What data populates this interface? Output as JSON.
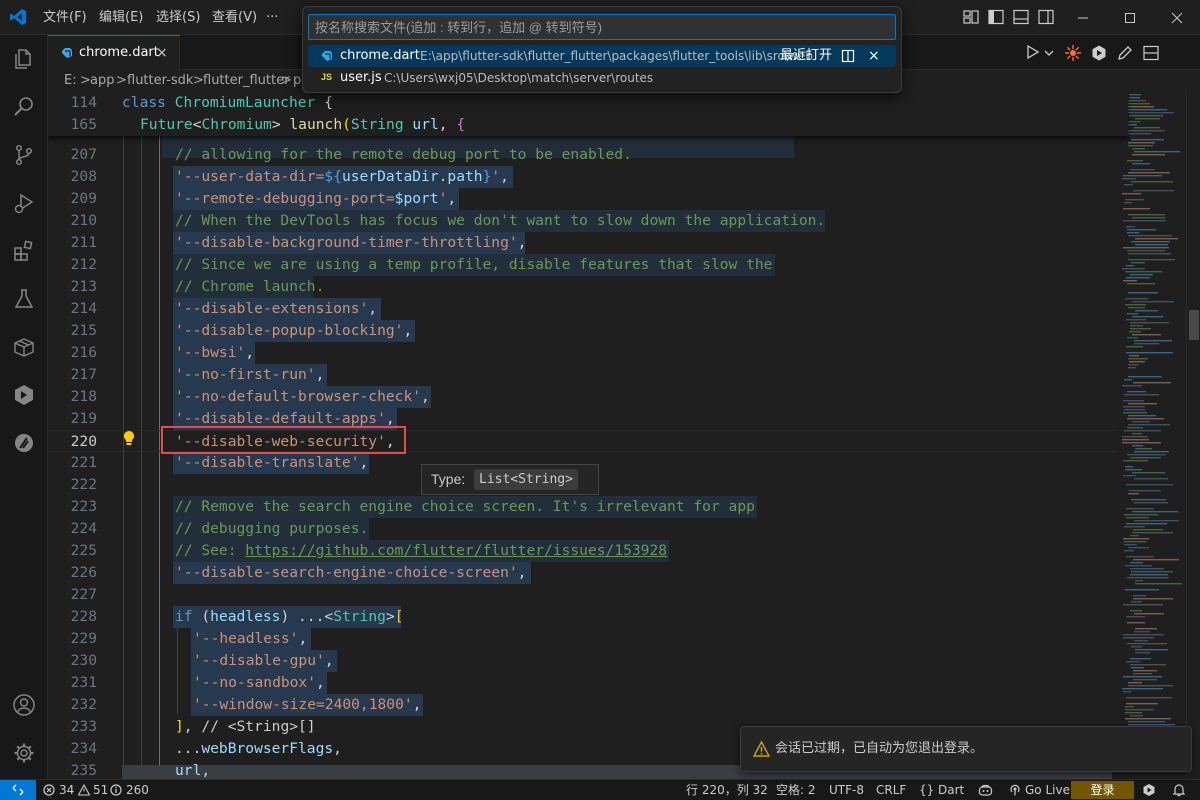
{
  "menu": {
    "file": "文件(F)",
    "edit": "编辑(E)",
    "selection": "选择(S)",
    "view": "查看(V)",
    "more": "···"
  },
  "tab": {
    "label": "chrome.dart",
    "close": "×"
  },
  "breadcrumb": {
    "drive": "E:",
    "p1": "app",
    "p2": "flutter-sdk",
    "p3": "flutter_flutter",
    "p4": "p",
    "sep": ">"
  },
  "sticky": [
    {
      "num": "114",
      "kw": "class",
      "name": "ChromiumLauncher",
      "brace": " {"
    },
    {
      "num": "165"
    }
  ],
  "line207": {
    "num": "207",
    "text": "// allowing for the remote debug port to be enabled."
  },
  "line208": {
    "num": "208",
    "open": "'--user-data-dir=",
    "interp": "${",
    "var": "userDataDir",
    "dot": ".",
    "prop": "path",
    "close_interp": "}",
    "end": "'",
    "comma": ","
  },
  "line209": {
    "num": "209",
    "open": "'--remote-debugging-port=",
    "var": "$port",
    "end": "'",
    "comma": ","
  },
  "line210": {
    "num": "210",
    "text": "// When the DevTools has focus we don't want to slow down the application."
  },
  "line211": {
    "num": "211",
    "str": "'--disable-background-timer-throttling'",
    "comma": ","
  },
  "line212": {
    "num": "212",
    "text": "// Since we are using a temp profile, disable features that slow the"
  },
  "line213": {
    "num": "213",
    "text": "// Chrome launch."
  },
  "line214": {
    "num": "214",
    "str": "'--disable-extensions'",
    "comma": ","
  },
  "line215": {
    "num": "215",
    "str": "'--disable-popup-blocking'",
    "comma": ","
  },
  "line216": {
    "num": "216",
    "str": "'--bwsi'",
    "comma": ","
  },
  "line217": {
    "num": "217",
    "str": "'--no-first-run'",
    "comma": ","
  },
  "line218": {
    "num": "218",
    "str": "'--no-default-browser-check'",
    "comma": ","
  },
  "line219": {
    "num": "219",
    "str": "'--disable-default-apps'",
    "comma": ","
  },
  "line220": {
    "num": "220",
    "str": "'--disable-web-security'",
    "comma": ","
  },
  "line221": {
    "num": "221",
    "str": "'--disable-translate'",
    "comma": ","
  },
  "line222": {
    "num": "222"
  },
  "line223": {
    "num": "223",
    "text": "// Remove the search engine choice screen. It's irrelevant for app"
  },
  "line224": {
    "num": "224",
    "text": "// debugging purposes."
  },
  "line225": {
    "num": "225",
    "prefix": "// See: ",
    "link": "https://github.com/flutter/flutter/issues/153928"
  },
  "line226": {
    "num": "226",
    "str": "'--disable-search-engine-choice-screen'",
    "comma": ","
  },
  "line227": {
    "num": "227"
  },
  "line228": {
    "num": "228",
    "kw": "if",
    "open": " (",
    "var": "headless",
    "close": ") ...",
    "lt": "<",
    "type": "String",
    "gt": ">",
    "br": "["
  },
  "line229": {
    "num": "229",
    "str": "'--headless'",
    "comma": ","
  },
  "line230": {
    "num": "230",
    "str": "'--disable-gpu'",
    "comma": ","
  },
  "line231": {
    "num": "231",
    "str": "'--no-sandbox'",
    "comma": ","
  },
  "line232": {
    "num": "232",
    "str": "'--window-size=2400,1800'",
    "comma": ","
  },
  "line233": {
    "num": "233",
    "br": "]",
    "comment": ", // <String>[]"
  },
  "line234": {
    "num": "234",
    "spread": "...",
    "var": "webBrowserFlags",
    "comma": ","
  },
  "line235": {
    "num": "235",
    "var": "url",
    "comma": ","
  },
  "hover": {
    "label": "Type:",
    "type": "List<String>"
  },
  "palette": {
    "placeholder": "按名称搜索文件(追加 : 转到行，追加 @ 转到符号)",
    "items": [
      {
        "name": "chrome.dart",
        "path": "E:\\app\\flutter-sdk\\flutter_flutter\\packages\\flutter_tools\\lib\\src\\web",
        "badge": "最近打开",
        "close": "×",
        "icon": "dart-icon"
      },
      {
        "name": "user.js",
        "path": "C:\\Users\\wxj05\\Desktop\\match\\server\\routes",
        "icon": "js-icon",
        "icon_text": "JS"
      }
    ]
  },
  "notification": {
    "text": "会话已过期，已自动为您退出登录。"
  },
  "status": {
    "errors": "34",
    "warnings": "51",
    "infos": "260",
    "position": "行 220，列 32",
    "spaces": "空格: 2",
    "encoding": "UTF-8",
    "eol": "CRLF",
    "language_brace": "{}",
    "language": "Dart",
    "golive": "Go Live",
    "login": "登录"
  },
  "colors": {
    "accent": "#0078d4",
    "string": "#ce9178",
    "comment": "#6a9955",
    "keyword": "#569cd6",
    "type": "#4ec9b0",
    "highlight_box": "#e74c4c"
  }
}
